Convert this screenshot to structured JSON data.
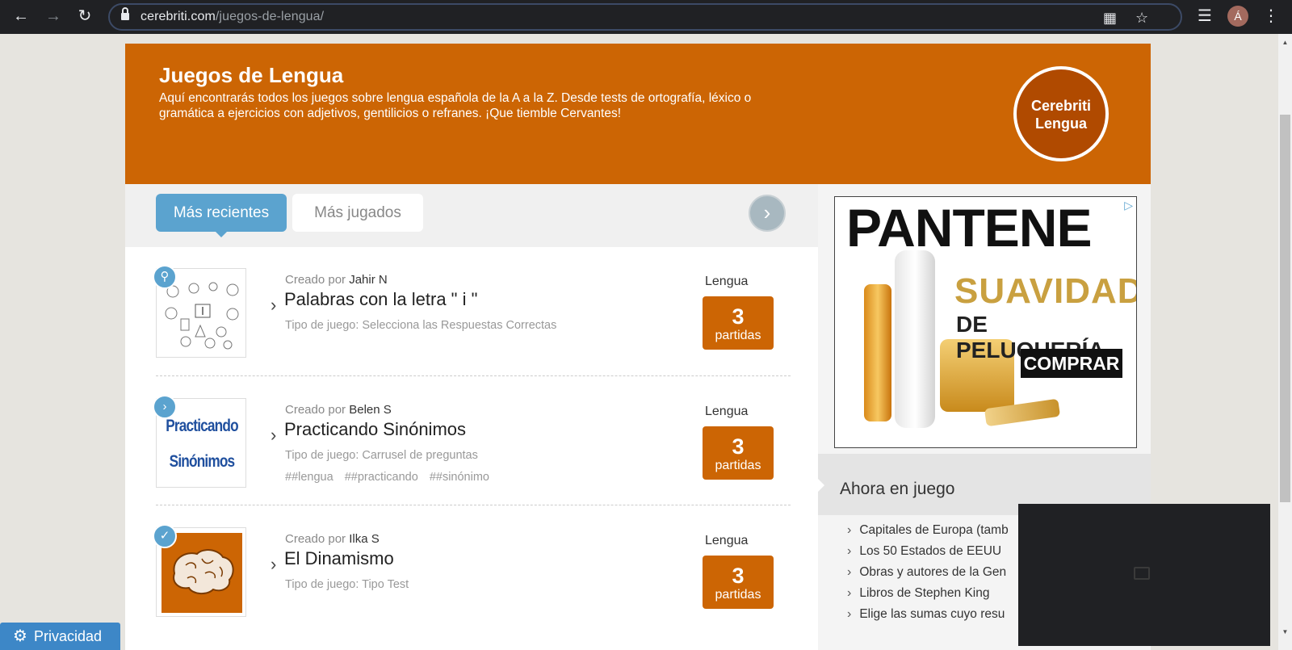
{
  "browser": {
    "url_host": "cerebriti.com",
    "url_path": "/juegos-de-lengua/",
    "avatar_initial": "Á"
  },
  "hero": {
    "title": "Juegos de Lengua",
    "description": "Aquí encontrarás todos los juegos sobre lengua española de la A a la Z. Desde tests de ortografía, léxico o gramática a ejercicios con adjetivos, gentilicios o refranes. ¡Que tiemble Cervantes!",
    "badge_line1": "Cerebriti",
    "badge_line2": "Lengua"
  },
  "tabs": [
    {
      "label": "Más recientes",
      "active": true
    },
    {
      "label": "Más jugados",
      "active": false
    }
  ],
  "games": [
    {
      "creator_prefix": "Creado por",
      "creator": "Jahir N",
      "title": "Palabras con la letra \" i \"",
      "type": "Tipo de juego: Selecciona las Respuestas Correctas",
      "tags": [],
      "category": "Lengua",
      "plays": "3",
      "plays_label": "partidas",
      "status_icon": "search-icon"
    },
    {
      "creator_prefix": "Creado por",
      "creator": "Belen S",
      "title": "Practicando Sinónimos",
      "type": "Tipo de juego: Carrusel de preguntas",
      "tags": [
        "##lengua",
        "##practicando",
        "##sinónimo"
      ],
      "category": "Lengua",
      "plays": "3",
      "plays_label": "partidas",
      "status_icon": "chevron-right-icon",
      "thumb_text_1": "Practicando",
      "thumb_text_2": "Sinónimos"
    },
    {
      "creator_prefix": "Creado por",
      "creator": "Ilka S",
      "title": "El Dinamismo",
      "type": "Tipo de juego: Tipo Test",
      "tags": [],
      "category": "Lengua",
      "plays": "3",
      "plays_label": "partidas",
      "status_icon": "check-icon"
    }
  ],
  "ad": {
    "brand": "PANTENE",
    "headline_1": "SUAVIDAD",
    "headline_2": "DE PELUQUERÍA",
    "cta": "COMPRAR"
  },
  "now_playing": {
    "title": "Ahora en juego",
    "items": [
      "Capitales de Europa (tamb",
      "Los 50 Estados de EEUU",
      "Obras y autores de la Gen",
      "Libros de Stephen King",
      "Elige las sumas cuyo resu"
    ]
  },
  "privacy": {
    "label": "Privacidad"
  },
  "colors": {
    "brand_orange": "#cc6504",
    "tab_blue": "#5ba3cf",
    "chrome_dark": "#202124"
  }
}
